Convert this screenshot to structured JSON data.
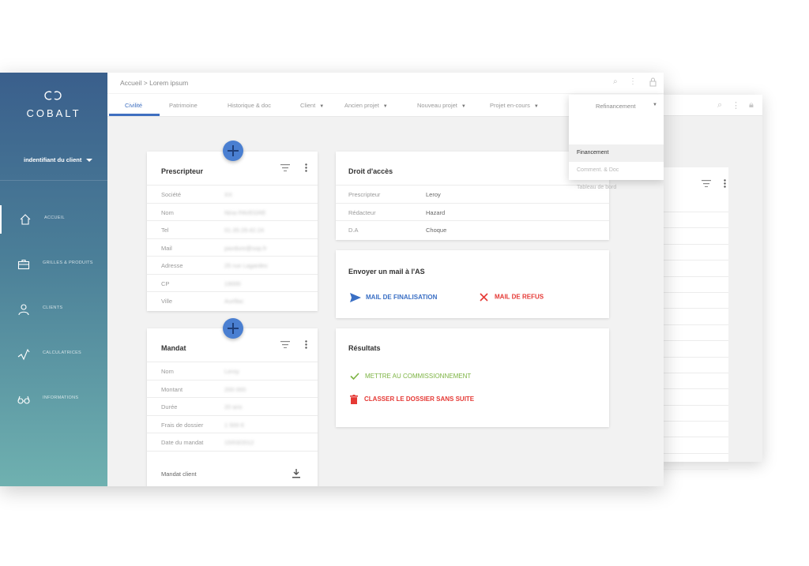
{
  "app": {
    "logo_text": "COBALT",
    "client_selector": "indentifiant du client"
  },
  "breadcrumb": "Accueil > Lorem ipsum",
  "sidebar": {
    "items": [
      {
        "label": "ACCUEIL",
        "icon": "home-icon"
      },
      {
        "label": "GRILLES & PRODUITS",
        "icon": "briefcase-icon"
      },
      {
        "label": "CLIENTS",
        "icon": "user-icon"
      },
      {
        "label": "CALCULATRICES",
        "icon": "chart-line-icon"
      },
      {
        "label": "INFORMATIONS",
        "icon": "glasses-icon"
      }
    ]
  },
  "tabs": [
    {
      "label": "Civilité"
    },
    {
      "label": "Patrimoine"
    },
    {
      "label": "Historique & doc"
    },
    {
      "label": "Client"
    },
    {
      "label": "Ancien projet"
    },
    {
      "label": "Nouveau projet"
    },
    {
      "label": "Projet en-cours"
    }
  ],
  "menu": {
    "title": "Refinancement",
    "items": [
      "Financement",
      "Comment. & Doc",
      "Tableau de bord"
    ]
  },
  "prescripteur": {
    "title": "Prescripteur",
    "rows": [
      {
        "k": "Société",
        "v": "XX"
      },
      {
        "k": "Nom",
        "v": "Nina PAVEGRE"
      },
      {
        "k": "Tel",
        "v": "01.35.29.42.24"
      },
      {
        "k": "Mail",
        "v": "pavdure@sop.fr"
      },
      {
        "k": "Adresse",
        "v": "25 rue Lagardes"
      },
      {
        "k": "CP",
        "v": "19000"
      },
      {
        "k": "Ville",
        "v": "Aurillac"
      }
    ]
  },
  "mandat": {
    "title": "Mandat",
    "rows": [
      {
        "k": "Nom",
        "v": "Leroy"
      },
      {
        "k": "Montant",
        "v": "200 000"
      },
      {
        "k": "Durée",
        "v": "20 ans"
      },
      {
        "k": "Frais de dossier",
        "v": "1 500 €"
      },
      {
        "k": "Date du mandat",
        "v": "15/03/2012"
      }
    ],
    "footer": "Mandat client"
  },
  "droit": {
    "title": "Droit d'accès",
    "rows": [
      {
        "k": "Prescripteur",
        "v": "Leroy"
      },
      {
        "k": "Rédacteur",
        "v": "Hazard"
      },
      {
        "k": "D.A",
        "v": "Choque"
      }
    ]
  },
  "mail": {
    "title": "Envoyer un mail à l'AS",
    "finalisation": "MAIL DE FINALISATION",
    "refus": "MAIL DE REFUS"
  },
  "resultats": {
    "title": "Résultats",
    "commission": "METTRE AU COMMISSIONNEMENT",
    "classer": "CLASSER LE DOSSIER SANS SUITE"
  },
  "colors": {
    "accent": "#3f6fc0",
    "red": "#e53935",
    "green": "#7cb342"
  }
}
